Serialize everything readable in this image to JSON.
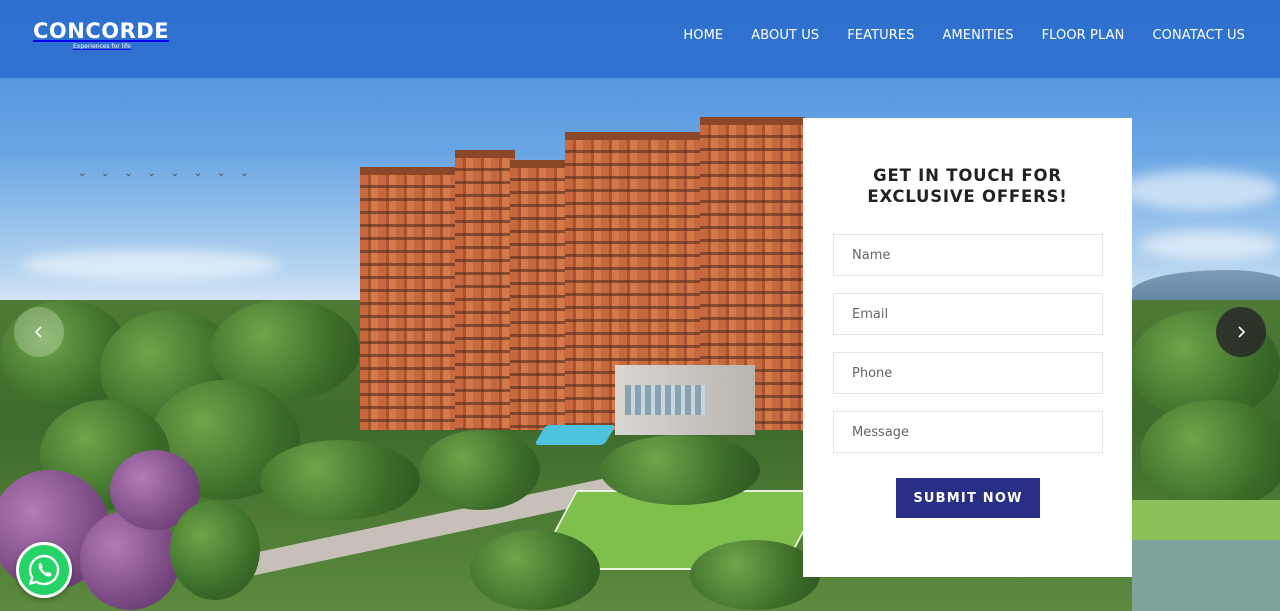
{
  "brand": {
    "name": "CONCORDE",
    "tagline": "Experiences for life"
  },
  "nav": {
    "items": [
      {
        "label": "HOME"
      },
      {
        "label": "ABOUT US"
      },
      {
        "label": "FEATURES"
      },
      {
        "label": "AMENITIES"
      },
      {
        "label": "FLOOR PLAN"
      },
      {
        "label": "CONATACT US"
      }
    ]
  },
  "hero": {
    "prev_icon": "chevron-left-icon",
    "next_icon": "chevron-right-icon"
  },
  "form": {
    "title_line1": "GET IN TOUCH FOR",
    "title_line2": "EXCLUSIVE OFFERS!",
    "name_placeholder": "Name",
    "email_placeholder": "Email",
    "phone_placeholder": "Phone",
    "message_placeholder": "Message",
    "submit_label": "SUBMIT NOW"
  },
  "whatsapp": {
    "icon": "whatsapp-icon"
  },
  "colors": {
    "header_bg": "#2b6ccd",
    "submit_bg": "#2a2f86",
    "whatsapp": "#25d366"
  }
}
